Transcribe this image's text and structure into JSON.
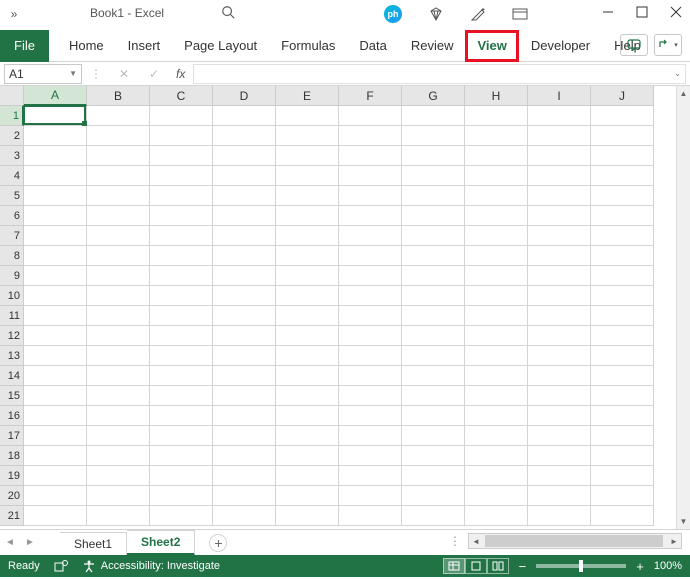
{
  "titlebar": {
    "title": "Book1  -  Excel",
    "qat_more": "»",
    "ph_badge": "ph"
  },
  "ribbon": {
    "tabs": [
      "File",
      "Home",
      "Insert",
      "Page Layout",
      "Formulas",
      "Data",
      "Review",
      "View",
      "Developer",
      "Help"
    ],
    "active_tab_index": 7,
    "highlighted_tab_index": 7
  },
  "namebox": {
    "value": "A1"
  },
  "formulabar": {
    "fx_label": "fx",
    "value": ""
  },
  "grid": {
    "columns": [
      "A",
      "B",
      "C",
      "D",
      "E",
      "F",
      "G",
      "H",
      "I",
      "J"
    ],
    "active_col_index": 0,
    "row_count": 21,
    "active_row_index": 0
  },
  "sheets": {
    "tabs": [
      "Sheet1",
      "Sheet2"
    ],
    "active_index": 1,
    "add_label": "+"
  },
  "statusbar": {
    "ready": "Ready",
    "accessibility": "Accessibility: Investigate",
    "zoom_pct": "100%",
    "zoom_minus": "−",
    "zoom_plus": "+"
  }
}
